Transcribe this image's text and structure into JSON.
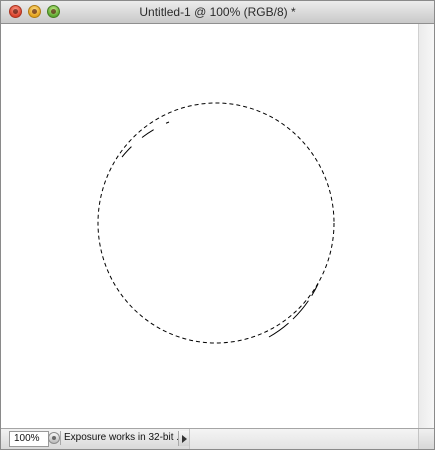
{
  "window": {
    "title": "Untitled-1 @ 100% (RGB/8) *"
  },
  "traffic_lights": {
    "close": "close-icon",
    "minimize": "minimize-icon",
    "zoom": "zoom-icon",
    "close_color": "#d8412c",
    "minimize_color": "#e3a21d",
    "zoom_color": "#5da731"
  },
  "canvas": {
    "background": "#ffffff",
    "selection": {
      "shape": "ellipse",
      "style": "marching-ants"
    }
  },
  "statusbar": {
    "zoom": "100%",
    "info_text": "Exposure works in 32-bit ...",
    "menu_icon": "status-menu-icon",
    "arrow_icon": "triangle-right-icon"
  }
}
